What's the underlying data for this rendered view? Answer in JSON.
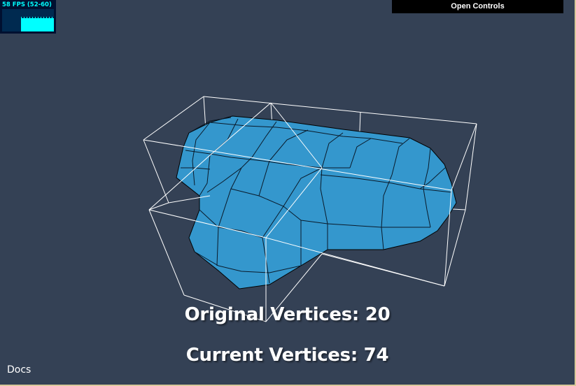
{
  "stats_panel": {
    "fps_text": "58 FPS (52-60)",
    "fps": 58,
    "fps_min": 52,
    "fps_max": 60
  },
  "controls": {
    "toggle_label": "Open Controls"
  },
  "overlay": {
    "original_vertices": "Original Vertices: 20",
    "current_vertices": "Current Vertices: 74"
  },
  "footer": {
    "docs_label": "Docs"
  },
  "colors": {
    "background": "#344155",
    "mesh_fill": "#3497cd",
    "mesh_edge": "#000000",
    "bounding_box": "#ffffff",
    "fps_accent": "#00ffff",
    "fps_panel": "#001030"
  }
}
